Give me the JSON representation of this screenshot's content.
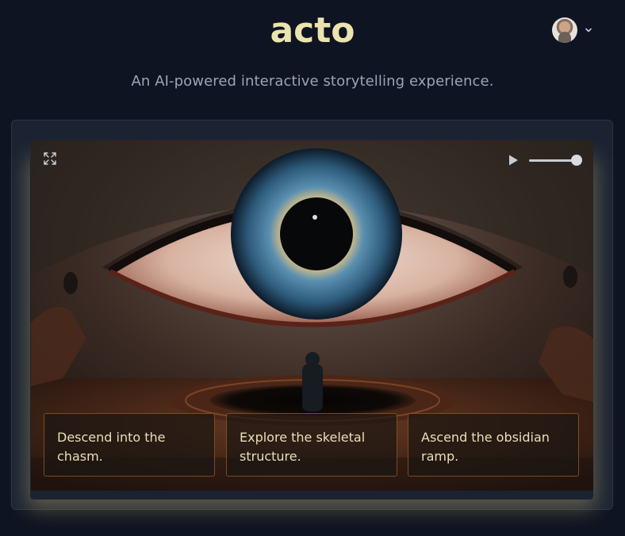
{
  "header": {
    "logo_text": "acto",
    "tagline": "An AI-powered interactive storytelling experience."
  },
  "user_menu": {
    "avatar_icon": "user-avatar",
    "dropdown_icon": "chevron-down-icon"
  },
  "player": {
    "fullscreen_icon": "expand-icon",
    "play_icon": "play-icon",
    "volume_level": 0.9,
    "choices": [
      {
        "label": "Descend into the chasm."
      },
      {
        "label": "Explore the skeletal structure."
      },
      {
        "label": "Ascend the obsidian ramp."
      }
    ]
  },
  "colors": {
    "background": "#0f1422",
    "panel": "#1b2333",
    "logo": "#ece4ae",
    "tagline": "#9ca3b7",
    "choice_text": "#eadfb8",
    "choice_border": "#965f28"
  }
}
